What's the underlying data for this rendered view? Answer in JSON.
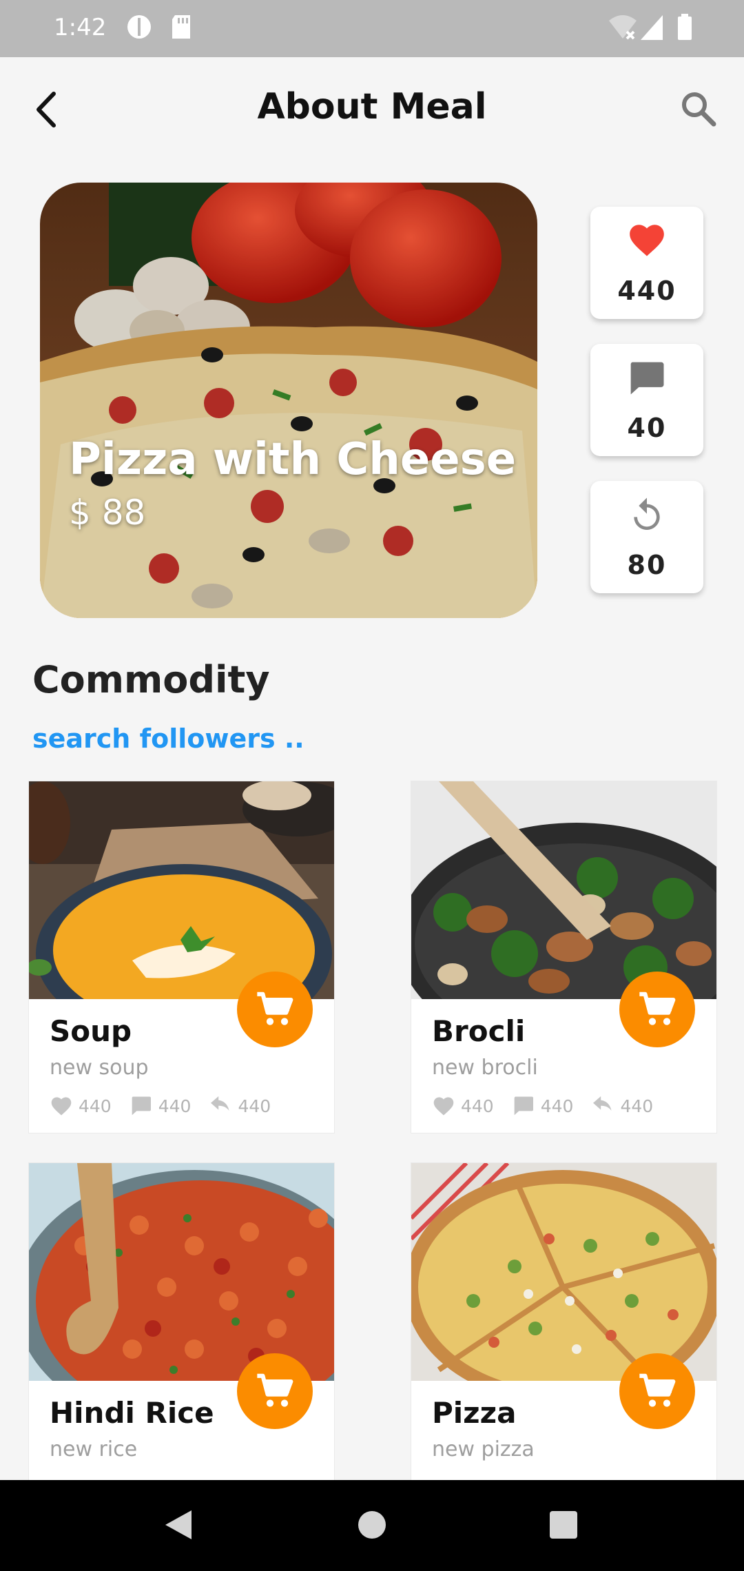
{
  "status_bar": {
    "time": "1:42"
  },
  "header": {
    "title": "About Meal"
  },
  "hero": {
    "title": "Pizza with Cheese",
    "price": "$ 88"
  },
  "stats": [
    {
      "icon": "heart-icon",
      "value": "440"
    },
    {
      "icon": "comment-icon",
      "value": "40"
    },
    {
      "icon": "replay-icon",
      "value": "80"
    }
  ],
  "section": {
    "title": "Commodity",
    "link": "search followers .."
  },
  "products": [
    {
      "name": "Soup",
      "desc": "new soup",
      "likes": "440",
      "comments": "440",
      "shares": "440"
    },
    {
      "name": "Brocli",
      "desc": "new brocli",
      "likes": "440",
      "comments": "440",
      "shares": "440"
    },
    {
      "name": "Hindi Rice",
      "desc": "new rice"
    },
    {
      "name": "Pizza",
      "desc": "new pizza"
    }
  ],
  "colors": {
    "accent": "#fb8c00",
    "link": "#2196f3",
    "heart": "#f44336"
  }
}
